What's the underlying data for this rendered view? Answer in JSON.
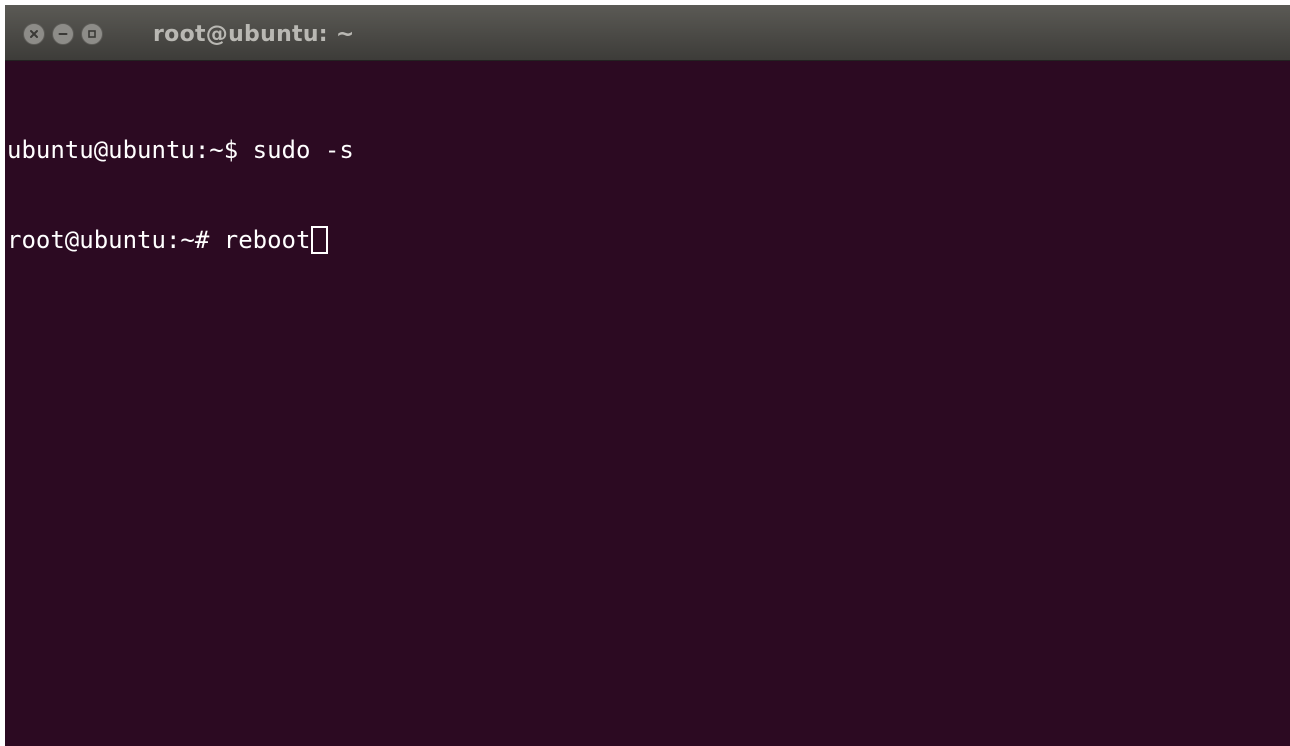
{
  "window": {
    "title": "root@ubuntu: ~"
  },
  "controls": {
    "close": "close-icon",
    "minimize": "minimize-icon",
    "maximize": "maximize-icon"
  },
  "terminal": {
    "lines": [
      {
        "prompt": "ubuntu@ubuntu:~$ ",
        "command": "sudo -s"
      },
      {
        "prompt": "root@ubuntu:~# ",
        "command": "reboot"
      }
    ]
  },
  "colors": {
    "terminal_bg": "#2c0a22",
    "titlebar_bg": "#4a4945",
    "text": "#ffffff"
  }
}
